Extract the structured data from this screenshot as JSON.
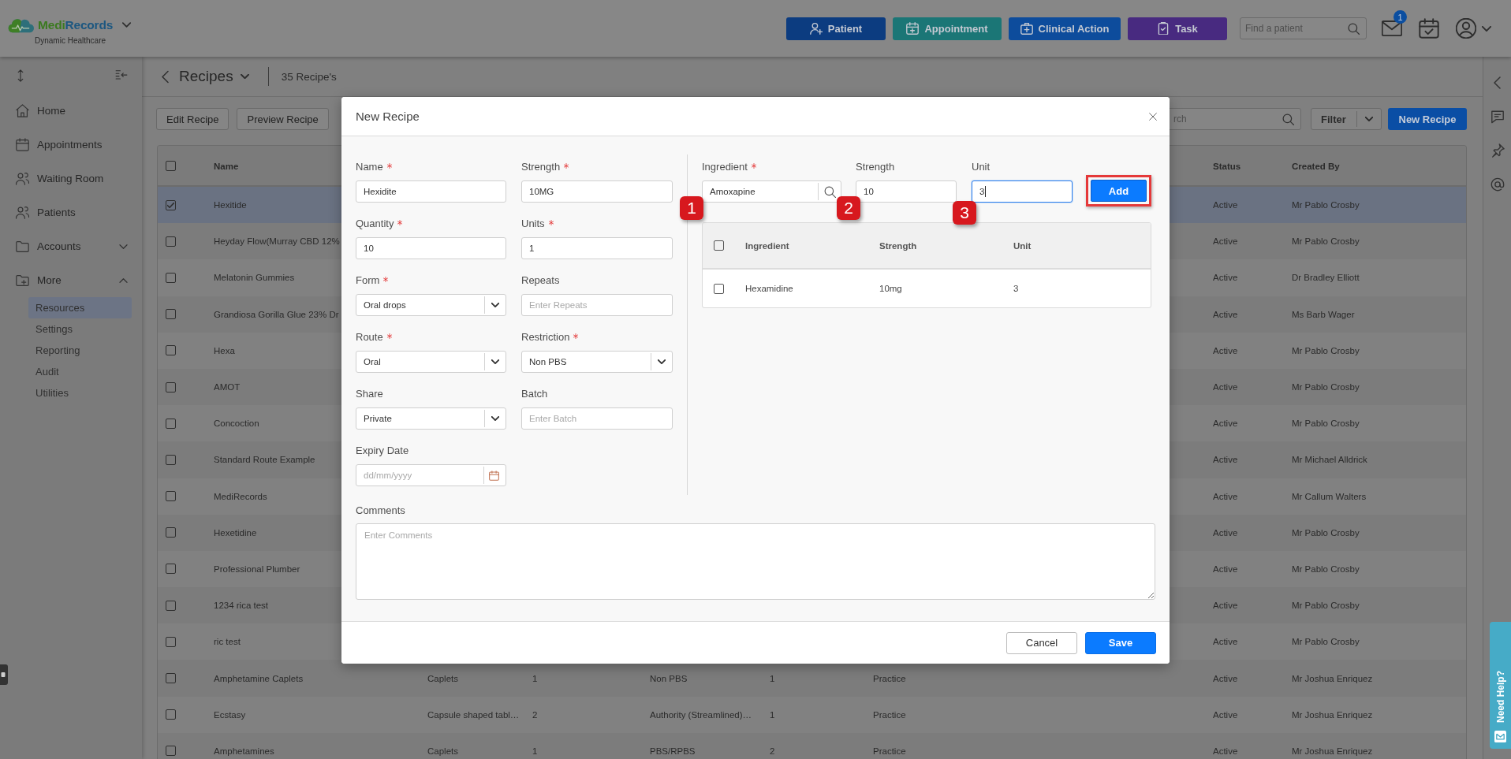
{
  "header": {
    "brand": {
      "name": [
        "Medi",
        "Records"
      ],
      "subtitle": "Dynamic Healthcare"
    },
    "actions": [
      {
        "label": "Patient",
        "kind": "patient"
      },
      {
        "label": "Appointment",
        "kind": "appointment"
      },
      {
        "label": "Clinical Action",
        "kind": "clinical"
      },
      {
        "label": "Task",
        "kind": "task"
      }
    ],
    "search": {
      "placeholder": "Find a patient"
    },
    "mail_count": "1"
  },
  "sidebar": {
    "items": [
      {
        "label": "Home",
        "kind": "link"
      },
      {
        "label": "Appointments",
        "kind": "link"
      },
      {
        "label": "Waiting Room",
        "kind": "link"
      },
      {
        "label": "Patients",
        "kind": "link"
      },
      {
        "label": "Accounts",
        "kind": "group",
        "expanded": false
      },
      {
        "label": "More",
        "kind": "group",
        "expanded": true,
        "children": [
          {
            "label": "Resources",
            "selected": true
          },
          {
            "label": "Settings",
            "selected": false
          },
          {
            "label": "Reporting",
            "selected": false
          },
          {
            "label": "Audit",
            "selected": false
          },
          {
            "label": "Utilities",
            "selected": false
          }
        ]
      }
    ]
  },
  "page": {
    "title": "Recipes",
    "count": "35 Recipe's",
    "toolbar": {
      "buttons": [
        "Edit Recipe",
        "Preview Recipe"
      ],
      "search": {
        "placeholder": "rch"
      },
      "filter": "Filter",
      "new_button": "New Recipe"
    }
  },
  "table": {
    "header": {
      "all_checked": false,
      "name": "Name",
      "status": "Status",
      "created_by": "Created By"
    },
    "rows": [
      {
        "selected": true,
        "name": "Hexitide",
        "status": "Active",
        "created_by": "Mr Pablo Crosby"
      },
      {
        "selected": false,
        "name": "Heyday Flow(Murray CBD 12%",
        "status": "Active",
        "created_by": "Mr Pablo Crosby"
      },
      {
        "selected": false,
        "name": "Melatonin Gummies",
        "status": "Active",
        "created_by": "Dr Bradley Elliott"
      },
      {
        "selected": false,
        "name": "Grandiosa Gorilla Glue 23% Dr",
        "status": "Active",
        "created_by": "Ms Barb Wager"
      },
      {
        "selected": false,
        "name": "Hexa",
        "status": "Active",
        "created_by": "Mr Pablo Crosby"
      },
      {
        "selected": false,
        "name": "AMOT",
        "status": "Active",
        "created_by": "Mr Pablo Crosby"
      },
      {
        "selected": false,
        "name": "Concoction",
        "status": "Active",
        "created_by": "Mr Pablo Crosby"
      },
      {
        "selected": false,
        "name": "Standard Route Example",
        "status": "Active",
        "created_by": "Mr Michael Alldrick"
      },
      {
        "selected": false,
        "name": "MediRecords",
        "status": "Active",
        "created_by": "Mr Callum Walters"
      },
      {
        "selected": false,
        "name": "Hexetidine",
        "status": "Active",
        "created_by": "Mr Pablo Crosby"
      },
      {
        "selected": false,
        "name": "Professional Plumber",
        "status": "Active",
        "created_by": "Mr Pablo Crosby"
      },
      {
        "selected": false,
        "name": "1234 rica test",
        "status": "Active",
        "created_by": "Mr Pablo Crosby"
      },
      {
        "selected": false,
        "name": "ric test",
        "status": "Active",
        "created_by": "Mr Pablo Crosby"
      },
      {
        "selected": false,
        "name": "Amphetamine Caplets",
        "column_3": "Caplets",
        "column_4": "1",
        "column_5": "Non PBS",
        "column_6": "1",
        "column_7": "Practice",
        "status": "Active",
        "created_by": "Mr Joshua Enriquez"
      },
      {
        "selected": false,
        "name": "Ecstasy",
        "column_3": "Capsule shaped tabl…",
        "column_4": "2",
        "column_5": "Authority (Streamlined)…",
        "column_6": "1",
        "column_7": "Practice",
        "status": "Active",
        "created_by": "Mr Joshua Enriquez"
      },
      {
        "selected": false,
        "name": "Amphetamines",
        "column_3": "Caplets",
        "column_4": "1",
        "column_5": "PBS/RPBS",
        "column_6": "2",
        "column_7": "Practice",
        "status": "Active",
        "created_by": "Mr Joshua Enriquez"
      }
    ]
  },
  "modal": {
    "title": "New Recipe",
    "fields": [
      {
        "label": "Name",
        "required": true,
        "kind": "text",
        "value": "Hexidite"
      },
      {
        "label": "Strength",
        "required": true,
        "kind": "text",
        "value": "10MG"
      },
      {
        "label": "Quantity",
        "required": true,
        "kind": "text",
        "value": "10"
      },
      {
        "label": "Units",
        "required": true,
        "kind": "text",
        "value": "1"
      },
      {
        "label": "Form",
        "required": true,
        "kind": "select",
        "value": "Oral drops"
      },
      {
        "label": "Repeats",
        "required": false,
        "kind": "text",
        "placeholder": "Enter Repeats"
      },
      {
        "label": "Route",
        "required": true,
        "kind": "select",
        "value": "Oral"
      },
      {
        "label": "Restriction",
        "required": true,
        "kind": "select",
        "value": "Non PBS"
      },
      {
        "label": "Share",
        "required": false,
        "kind": "select",
        "value": "Private"
      },
      {
        "label": "Batch",
        "required": false,
        "kind": "text",
        "placeholder": "Enter Batch"
      },
      {
        "label": "Expiry Date",
        "required": false,
        "kind": "date",
        "placeholder": "dd/mm/yyyy"
      }
    ],
    "ingredient_entry": {
      "fields": [
        {
          "label": "Ingredient",
          "required": true,
          "kind": "search",
          "value": "Amoxapine",
          "focused": false,
          "callout": "1"
        },
        {
          "label": "Strength",
          "required": false,
          "kind": "text",
          "value": "10",
          "focused": false,
          "callout": "2"
        },
        {
          "label": "Unit",
          "required": false,
          "kind": "text",
          "value": "3",
          "focused": true,
          "callout": "3"
        }
      ],
      "add_button": {
        "label": "Add",
        "highlighted": true
      }
    },
    "ingredients_table": {
      "columns": [
        "Ingredient",
        "Strength",
        "Unit"
      ],
      "all_checked": false,
      "rows": [
        {
          "selected": false,
          "ingredient": "Hexamidine",
          "strength": "10mg",
          "unit": "3"
        }
      ]
    },
    "comments": {
      "label": "Comments",
      "placeholder": "Enter Comments"
    },
    "buttons": [
      {
        "label": "Cancel",
        "kind": "secondary"
      },
      {
        "label": "Save",
        "kind": "primary"
      }
    ]
  },
  "help_tab": {
    "label": "Need Help?"
  }
}
